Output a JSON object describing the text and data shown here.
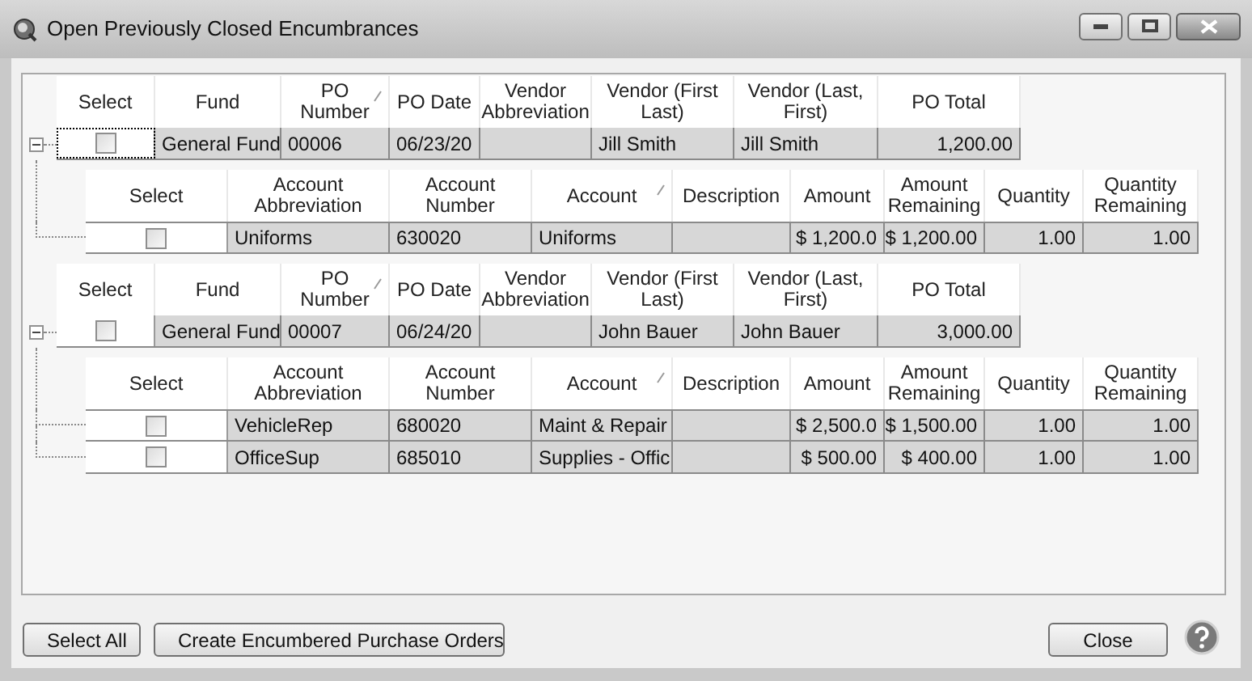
{
  "window": {
    "title": "Open Previously Closed Encumbrances"
  },
  "purchase_orders": [
    {
      "expanded": true,
      "columns": [
        {
          "label": "Select",
          "sorted": false
        },
        {
          "label": "Fund",
          "sorted": false
        },
        {
          "label": "PO Number",
          "sorted": true
        },
        {
          "label": "PO Date",
          "sorted": false
        },
        {
          "label": "Vendor Abbreviation",
          "sorted": false
        },
        {
          "label": "Vendor (First Last)",
          "sorted": false
        },
        {
          "label": "Vendor (Last, First)",
          "sorted": false
        },
        {
          "label": "PO Total",
          "sorted": false
        }
      ],
      "row": {
        "checked": false,
        "focused": true,
        "cells": [
          "General Fund",
          "00006",
          "06/23/20",
          "",
          "Jill Smith",
          "Jill Smith",
          "1,200.00"
        ]
      },
      "line_columns": [
        {
          "label": "Select",
          "sorted": false
        },
        {
          "label": "Account Abbreviation",
          "sorted": false
        },
        {
          "label": "Account Number",
          "sorted": false
        },
        {
          "label": "Account",
          "sorted": true
        },
        {
          "label": "Description",
          "sorted": false
        },
        {
          "label": "Amount",
          "sorted": false
        },
        {
          "label": "Amount Remaining",
          "sorted": false
        },
        {
          "label": "Quantity",
          "sorted": false
        },
        {
          "label": "Quantity Remaining",
          "sorted": false
        }
      ],
      "lines": [
        {
          "checked": false,
          "cells": [
            "Uniforms",
            "630020",
            "Uniforms",
            "",
            "$ 1,200.0",
            "$ 1,200.00",
            "1.00",
            "1.00"
          ]
        }
      ]
    },
    {
      "expanded": true,
      "columns": [
        {
          "label": "Select",
          "sorted": false
        },
        {
          "label": "Fund",
          "sorted": false
        },
        {
          "label": "PO Number",
          "sorted": true
        },
        {
          "label": "PO Date",
          "sorted": false
        },
        {
          "label": "Vendor Abbreviation",
          "sorted": false
        },
        {
          "label": "Vendor (First Last)",
          "sorted": false
        },
        {
          "label": "Vendor (Last, First)",
          "sorted": false
        },
        {
          "label": "PO Total",
          "sorted": false
        }
      ],
      "row": {
        "checked": false,
        "focused": false,
        "cells": [
          "General Fund",
          "00007",
          "06/24/20",
          "",
          "John Bauer",
          "John Bauer",
          "3,000.00"
        ]
      },
      "line_columns": [
        {
          "label": "Select",
          "sorted": false
        },
        {
          "label": "Account Abbreviation",
          "sorted": false
        },
        {
          "label": "Account Number",
          "sorted": false
        },
        {
          "label": "Account",
          "sorted": true
        },
        {
          "label": "Description",
          "sorted": false
        },
        {
          "label": "Amount",
          "sorted": false
        },
        {
          "label": "Amount Remaining",
          "sorted": false
        },
        {
          "label": "Quantity",
          "sorted": false
        },
        {
          "label": "Quantity Remaining",
          "sorted": false
        }
      ],
      "lines": [
        {
          "checked": false,
          "cells": [
            "VehicleRep",
            "680020",
            "Maint & Repair",
            "",
            "$ 2,500.0",
            "$ 1,500.00",
            "1.00",
            "1.00"
          ]
        },
        {
          "checked": false,
          "cells": [
            "OfficeSup",
            "685010",
            "Supplies - Offic",
            "",
            "$ 500.00",
            "$ 400.00",
            "1.00",
            "1.00"
          ]
        }
      ]
    }
  ],
  "buttons": [
    "Select All",
    "Create Encumbered Purchase Orders"
  ],
  "close_button": "Close"
}
